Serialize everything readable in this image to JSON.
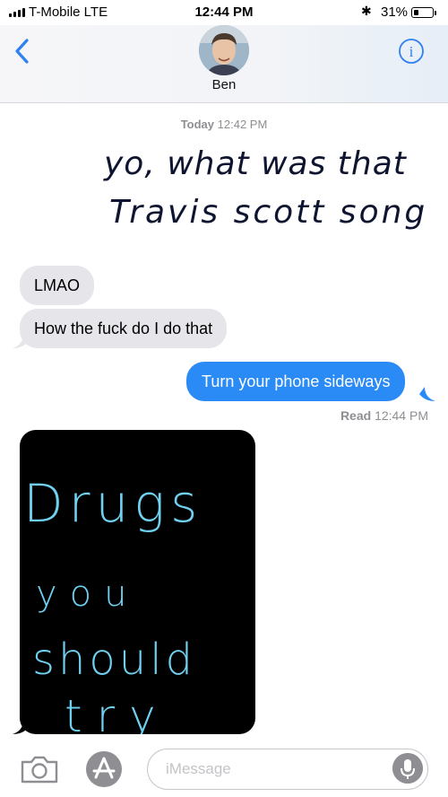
{
  "status_bar": {
    "carrier": "T-Mobile  LTE",
    "time": "12:44 PM",
    "bluetooth": "✱",
    "battery_percent": "31%",
    "battery_level": 0.31
  },
  "header": {
    "contact_name": "Ben",
    "info_label": "i"
  },
  "thread": {
    "timestamp_day": "Today",
    "timestamp_time": "12:42 PM",
    "received_1": "LMAO",
    "received_2": "How the fuck do I do that",
    "sent_1": "Turn your phone sideways",
    "read_label": "Read",
    "read_time": "12:44 PM",
    "handwritten_1_line1": "yo, what was that",
    "handwritten_1_line2": "Travis scott song",
    "handwritten_2": [
      "Drugs",
      "you",
      "should",
      "try"
    ]
  },
  "input": {
    "placeholder": "iMessage"
  },
  "colors": {
    "blue_bubble": "#2a8af6",
    "gray_bubble": "#e5e5ea",
    "ios_blue": "#2f80f0",
    "ink_blue": "#6fd0f0"
  },
  "icons": [
    "back-chevron-icon",
    "info-icon",
    "camera-icon",
    "app-store-icon",
    "microphone-icon"
  ]
}
